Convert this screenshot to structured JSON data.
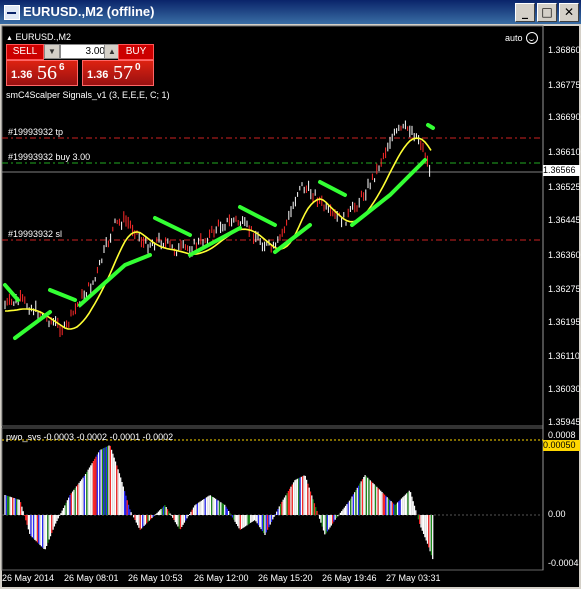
{
  "window": {
    "title": "EURUSD.,M2 (offline)",
    "buttons": [
      "_",
      "□",
      "✕"
    ]
  },
  "chart": {
    "symbol_label": "EURUSD.,M2",
    "auto_label": "auto",
    "indicator_label": "smC4Scalper Signals_v1 (3, E,E,E, C; 1)",
    "oneclick": {
      "sell_label": "SELL",
      "buy_label": "BUY",
      "lot": "3.00",
      "sell_prefix": "1.36",
      "sell_big": "56",
      "sell_sup": "6",
      "buy_prefix": "1.36",
      "buy_big": "57",
      "buy_sup": "0"
    },
    "order_lines": {
      "tp": "#19993932 tp",
      "buy": "#19993932 buy 3.00",
      "sl": "#19993932 sl"
    },
    "price_axis": [
      "1.36860",
      "1.36775",
      "1.36690",
      "1.36610",
      "1.36525",
      "1.36445",
      "1.36360",
      "1.36275",
      "1.36195",
      "1.36110",
      "1.36030",
      "1.35945"
    ],
    "current_price": "1.36566",
    "sub_indicator": {
      "label": "pwo_svs -0.0003 -0.0002 -0.0001 -0.0002",
      "axis": [
        "0.0008",
        "0.00050",
        "0.00",
        "-0.0004"
      ],
      "highlight": "0.00050"
    },
    "time_axis": [
      "26 May 2014",
      "26 May 08:01",
      "26 May 10:53",
      "26 May 12:00",
      "26 May 15:20",
      "26 May 19:46",
      "27 May 03:31"
    ]
  },
  "colors": {
    "background": "#000000",
    "candles": "#ff2a2a",
    "ma_yellow": "#ffff33",
    "signal_green": "#33ff33",
    "tp_line": "#cc2222",
    "buy_line": "#22aa22",
    "sl_line": "#cc2222"
  },
  "chart_data": {
    "type": "line",
    "note_series": "price series + moving average + histogram oscillator",
    "x": [
      "26 May 2014",
      "26 May 08:01",
      "26 May 10:53",
      "26 May 12:00",
      "26 May 15:20",
      "26 May 19:46",
      "27 May 03:31"
    ],
    "series": [
      {
        "name": "price",
        "values": [
          1.362,
          1.3624,
          1.3637,
          1.3643,
          1.3651,
          1.365,
          1.3657
        ]
      }
    ],
    "ylim": [
      1.35945,
      1.3686
    ]
  }
}
